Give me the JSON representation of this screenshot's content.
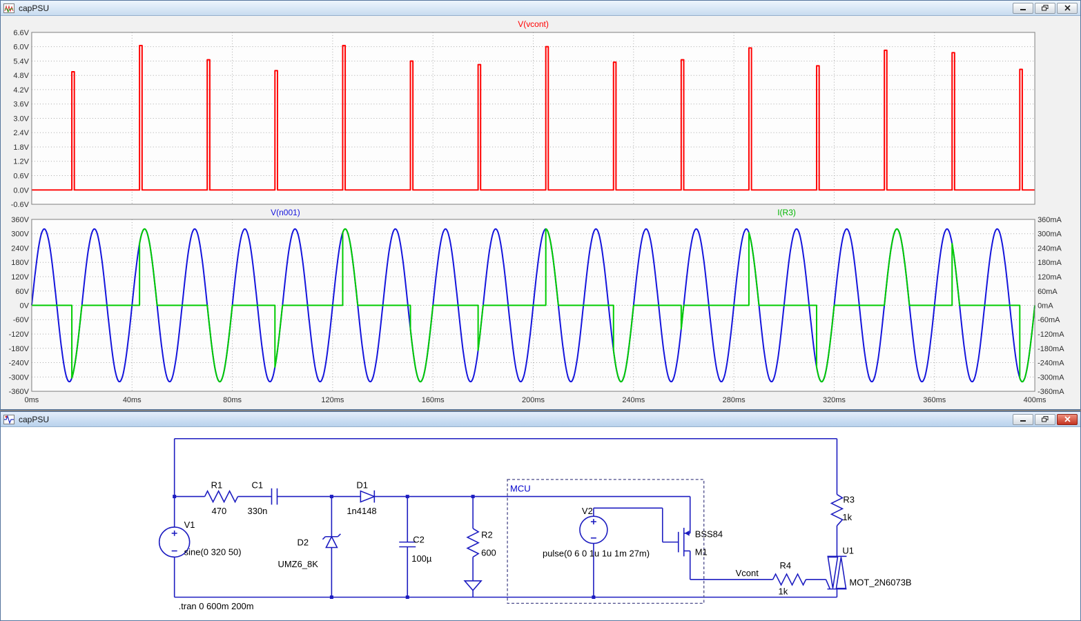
{
  "plot_window": {
    "title": "capPSU"
  },
  "schematic_window": {
    "title": "capPSU",
    "directive": ".tran 0 600m 200m",
    "mcu_label": "MCU",
    "net_label": "Vcont",
    "components": {
      "V1": {
        "name": "V1",
        "value": "sine(0 320 50)"
      },
      "R1": {
        "name": "R1",
        "value": "470"
      },
      "C1": {
        "name": "C1",
        "value": "330n"
      },
      "D1": {
        "name": "D1",
        "value": "1n4148"
      },
      "D2": {
        "name": "D2",
        "value": "UMZ6_8K"
      },
      "C2": {
        "name": "C2",
        "value": "100µ"
      },
      "R2": {
        "name": "R2",
        "value": "600"
      },
      "V2": {
        "name": "V2",
        "value": "pulse(0 6 0 1u 1u 1m 27m)"
      },
      "M1": {
        "name": "M1",
        "value": "BSS84"
      },
      "R3": {
        "name": "R3",
        "value": "1k"
      },
      "R4": {
        "name": "R4",
        "value": "1k"
      },
      "U1": {
        "name": "U1",
        "value": "MOT_2N6073B"
      }
    }
  },
  "chart_data": [
    {
      "type": "line",
      "pane": "top",
      "title": "V(vcont)",
      "title_color": "#ff0000",
      "xlim_ms": [
        0,
        400
      ],
      "ylim": [
        -0.6,
        6.6
      ],
      "ytick_step": 0.6,
      "grid": true,
      "yticklabels": [
        "6.6V",
        "6.0V",
        "5.4V",
        "4.8V",
        "4.2V",
        "3.6V",
        "3.0V",
        "2.4V",
        "1.8V",
        "1.2V",
        "0.6V",
        "0.0V",
        "-0.6V"
      ],
      "series": [
        {
          "name": "V(vcont)",
          "color": "#ff0000",
          "kind": "pulse-train",
          "baseline_V": 0,
          "pulse_width_ms": 1,
          "pulse_times_ms": [
            16,
            43,
            70,
            97,
            124,
            151,
            178,
            205,
            232,
            259,
            286,
            313,
            340,
            367,
            394
          ],
          "pulse_peaks_V": [
            4.95,
            6.05,
            5.45,
            5.0,
            6.05,
            5.4,
            5.25,
            6.0,
            5.35,
            5.45,
            5.95,
            5.2,
            5.85,
            5.75,
            5.05
          ]
        }
      ]
    },
    {
      "type": "line",
      "pane": "bottom",
      "xlim_ms": [
        0,
        400
      ],
      "xticklabels": [
        "0ms",
        "40ms",
        "80ms",
        "120ms",
        "160ms",
        "200ms",
        "240ms",
        "280ms",
        "320ms",
        "360ms",
        "400ms"
      ],
      "grid": true,
      "left_axis": {
        "label": "V(n001)",
        "label_color": "#1414dc",
        "ylim": [
          -360,
          360
        ],
        "yticklabels": [
          "360V",
          "300V",
          "240V",
          "180V",
          "120V",
          "60V",
          "0V",
          "-60V",
          "-120V",
          "-180V",
          "-240V",
          "-300V",
          "-360V"
        ]
      },
      "right_axis": {
        "label": "I(R3)",
        "label_color": "#00b400",
        "ylim": [
          -360,
          360
        ],
        "yticklabels": [
          "360mA",
          "300mA",
          "240mA",
          "180mA",
          "120mA",
          "60mA",
          "0mA",
          "-60mA",
          "-120mA",
          "-180mA",
          "-240mA",
          "-300mA",
          "-360mA"
        ]
      },
      "series": [
        {
          "name": "V(n001)",
          "color": "#1414dc",
          "axis": "left",
          "kind": "sine",
          "amplitude": 320,
          "period_ms": 20,
          "phase_deg": 0,
          "offset": 0
        },
        {
          "name": "I(R3)",
          "color": "#00cc00",
          "axis": "right",
          "kind": "gated-sine",
          "amplitude": 320,
          "period_ms": 20,
          "conduction_windows_ms": [
            [
              16,
              20
            ],
            [
              43,
              50
            ],
            [
              70,
              80
            ],
            [
              97,
              100
            ],
            [
              124,
              130
            ],
            [
              151,
              160
            ],
            [
              178,
              180
            ],
            [
              205,
              210
            ],
            [
              232,
              240
            ],
            [
              259,
              260
            ],
            [
              286,
              290
            ],
            [
              313,
              320
            ],
            [
              340,
              350
            ],
            [
              367,
              370
            ],
            [
              394,
              400
            ]
          ]
        }
      ]
    }
  ]
}
